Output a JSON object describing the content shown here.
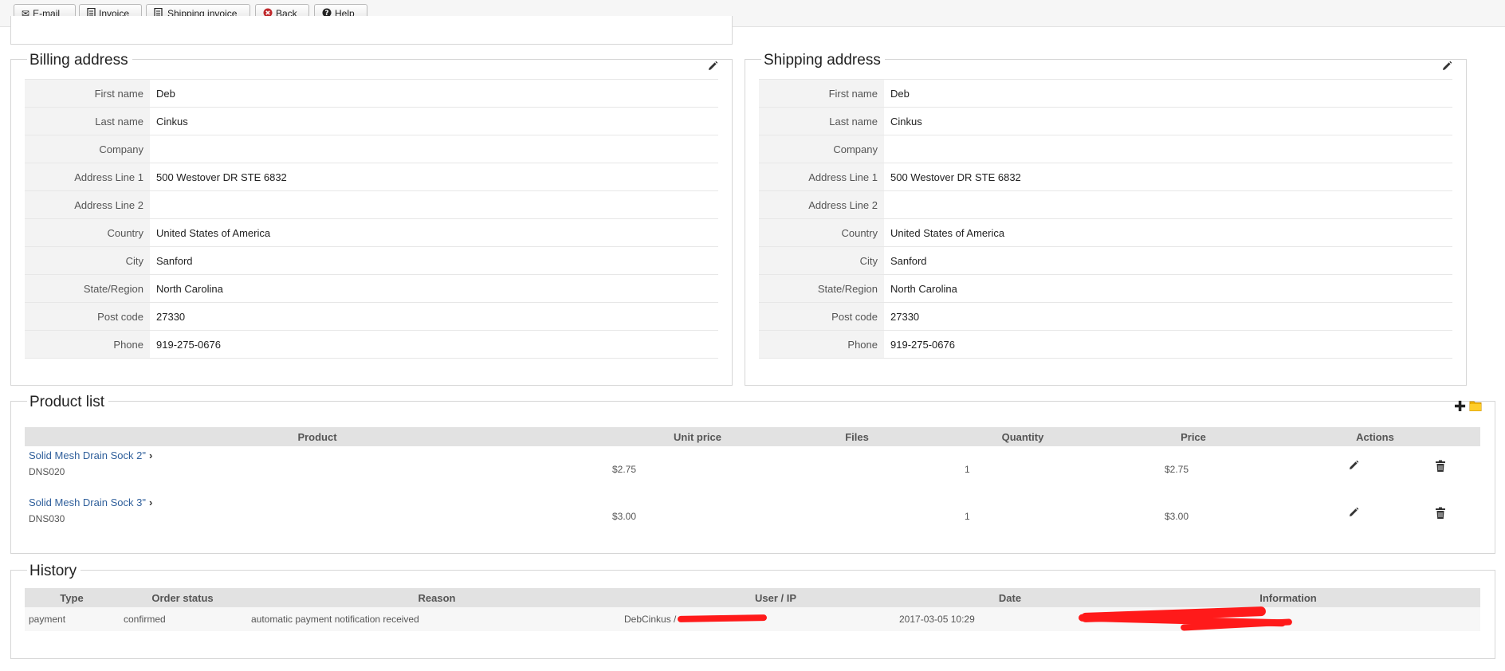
{
  "toolbar": {
    "email_label": "E-mail",
    "invoice_label": "Invoice",
    "shipping_invoice_label": "Shipping invoice",
    "back_label": "Back",
    "help_label": "Help"
  },
  "billing": {
    "title": "Billing address",
    "rows": [
      {
        "label": "First name",
        "value": "Deb"
      },
      {
        "label": "Last name",
        "value": "Cinkus"
      },
      {
        "label": "Company",
        "value": ""
      },
      {
        "label": "Address Line 1",
        "value": "500 Westover DR STE 6832"
      },
      {
        "label": "Address Line 2",
        "value": ""
      },
      {
        "label": "Country",
        "value": "United States of America"
      },
      {
        "label": "City",
        "value": "Sanford"
      },
      {
        "label": "State/Region",
        "value": "North Carolina"
      },
      {
        "label": "Post code",
        "value": "27330"
      },
      {
        "label": "Phone",
        "value": "919-275-0676"
      }
    ]
  },
  "shipping": {
    "title": "Shipping address",
    "rows": [
      {
        "label": "First name",
        "value": "Deb"
      },
      {
        "label": "Last name",
        "value": "Cinkus"
      },
      {
        "label": "Company",
        "value": ""
      },
      {
        "label": "Address Line 1",
        "value": "500 Westover DR STE 6832"
      },
      {
        "label": "Address Line 2",
        "value": ""
      },
      {
        "label": "Country",
        "value": "United States of America"
      },
      {
        "label": "City",
        "value": "Sanford"
      },
      {
        "label": "State/Region",
        "value": "North Carolina"
      },
      {
        "label": "Post code",
        "value": "27330"
      },
      {
        "label": "Phone",
        "value": "919-275-0676"
      }
    ]
  },
  "products": {
    "title": "Product list",
    "headers": [
      "Product",
      "Unit price",
      "Files",
      "Quantity",
      "Price",
      "Actions"
    ],
    "items": [
      {
        "name": "Solid Mesh Drain Sock 2\"",
        "code": "DNS020",
        "unit_price": "$2.75",
        "quantity": "1",
        "price": "$2.75"
      },
      {
        "name": "Solid Mesh Drain Sock 3\"",
        "code": "DNS030",
        "unit_price": "$3.00",
        "quantity": "1",
        "price": "$3.00"
      }
    ]
  },
  "history": {
    "title": "History",
    "headers": [
      "Type",
      "Order status",
      "Reason",
      "User / IP",
      "Date",
      "Information"
    ],
    "rows": [
      {
        "type": "payment",
        "status": "confirmed",
        "reason": "automatic payment notification received",
        "user": "DebCinkus / ",
        "date": "2017-03-05 10:29"
      }
    ]
  },
  "icons": {
    "email": "envelope-icon",
    "invoice": "document-icon",
    "shipping_invoice": "truck-icon",
    "back": "close-circle-icon",
    "help": "question-circle-icon",
    "edit": "pencil-icon",
    "delete": "trash-icon",
    "add": "plus-icon",
    "folder": "folder-icon"
  },
  "colors": {
    "link": "#2f5f9b",
    "redaction": "#ff1a1a",
    "header_bg": "#e2e2e2"
  }
}
